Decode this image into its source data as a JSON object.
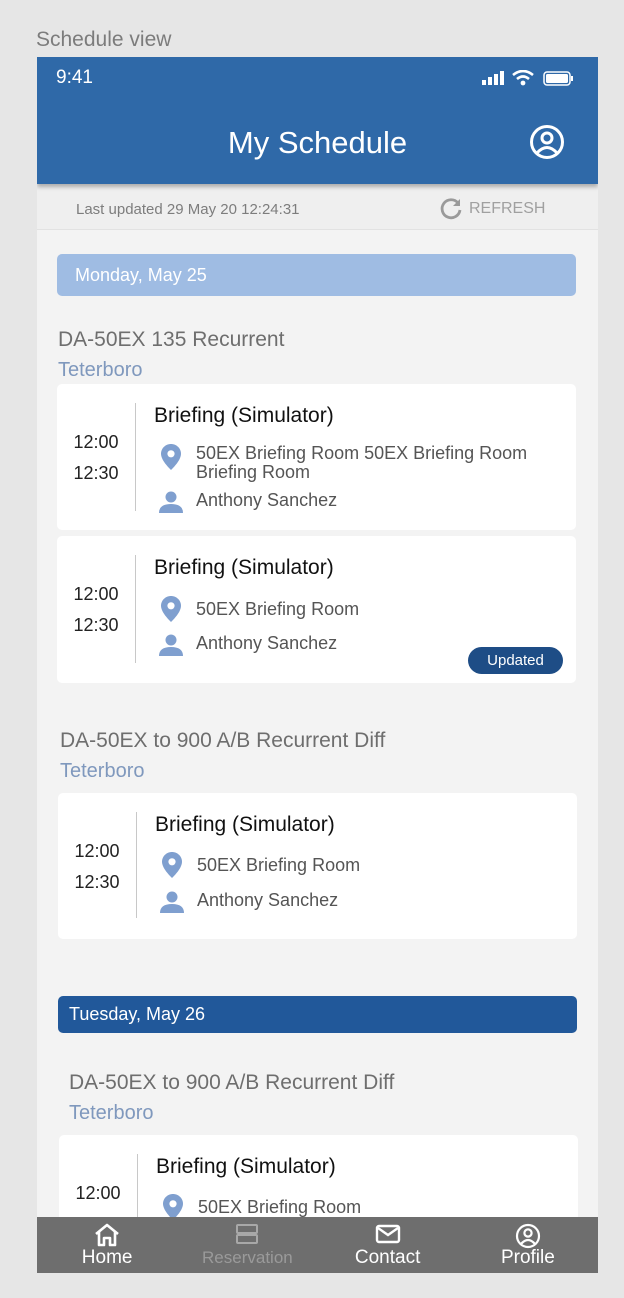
{
  "frame_label": "Schedule view",
  "status_bar": {
    "time": "9:41"
  },
  "header": {
    "title": "My Schedule"
  },
  "updated": {
    "text": "Last updated 29 May 20 12:24:31",
    "refresh_label": "REFRESH"
  },
  "days": [
    {
      "label": "Monday, May 25",
      "courses": [
        {
          "title": "DA-50EX 135 Recurrent",
          "location": "Teterboro",
          "events": [
            {
              "title": "Briefing (Simulator)",
              "start": "12:00",
              "end": "12:30",
              "room": "50EX Briefing Room 50EX Briefing Room Briefing Room",
              "instructor": "Anthony Sanchez"
            },
            {
              "title": "Briefing (Simulator)",
              "start": "12:00",
              "end": "12:30",
              "room": "50EX Briefing Room",
              "instructor": "Anthony Sanchez",
              "badge": "Updated"
            }
          ]
        },
        {
          "title": "DA-50EX to 900 A/B Recurrent Diff",
          "location": "Teterboro",
          "events": [
            {
              "title": "Briefing (Simulator)",
              "start": "12:00",
              "end": "12:30",
              "room": "50EX Briefing Room",
              "instructor": "Anthony Sanchez"
            }
          ]
        }
      ]
    },
    {
      "label": "Tuesday, May 26",
      "courses": [
        {
          "title": "DA-50EX to 900 A/B Recurrent Diff",
          "location": "Teterboro",
          "events": [
            {
              "title": "Briefing (Simulator)",
              "start": "12:00",
              "room": "50EX Briefing Room"
            }
          ]
        }
      ]
    }
  ],
  "nav": [
    {
      "label": "Home",
      "icon": "home-icon"
    },
    {
      "label": "Reservation",
      "icon": "reservation-icon"
    },
    {
      "label": "Contact",
      "icon": "mail-icon"
    },
    {
      "label": "Profile",
      "icon": "profile-icon"
    }
  ],
  "colors": {
    "header": "#2f69a8",
    "day_light": "#9fbce3",
    "day_dark": "#21589a",
    "badge": "#1e4d86",
    "accent_icon": "#7f9fcf",
    "nav": "#6e6e6e"
  }
}
